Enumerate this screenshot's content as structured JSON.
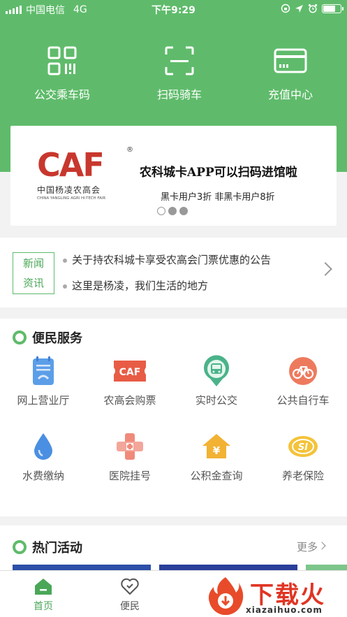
{
  "status_bar": {
    "carrier": "中国电信",
    "network": "4G",
    "time": "下午9:29"
  },
  "quick_actions": [
    {
      "label": "公交乘车码",
      "icon": "qr-code-icon"
    },
    {
      "label": "扫码骑车",
      "icon": "scan-icon"
    },
    {
      "label": "充值中心",
      "icon": "card-icon"
    }
  ],
  "banner": {
    "logo_text": "CAF",
    "logo_cn": "中国杨凌农高会",
    "logo_en": "CHINA YANGLING AGRI HI-TECH FAIR",
    "title": "农科城卡APP可以扫码进馆啦",
    "subtitle": "黑卡用户3折  非黑卡用户8折",
    "page_count": 3,
    "active_page": 1
  },
  "news": {
    "tag": "新闻资讯",
    "tag_line1": "新闻",
    "tag_line2": "资讯",
    "items": [
      "关于持农科城卡享受农高会门票优惠的公告",
      "这里是杨凌，我们生活的地方"
    ]
  },
  "services": {
    "title": "便民服务",
    "items": [
      {
        "label": "网上营业厅",
        "icon": "online-hall-icon"
      },
      {
        "label": "农高会购票",
        "icon": "caf-ticket-icon"
      },
      {
        "label": "实时公交",
        "icon": "bus-icon"
      },
      {
        "label": "公共自行车",
        "icon": "bicycle-icon"
      },
      {
        "label": "水费缴纳",
        "icon": "water-drop-icon"
      },
      {
        "label": "医院挂号",
        "icon": "hospital-icon"
      },
      {
        "label": "公积金查询",
        "icon": "housing-fund-icon"
      },
      {
        "label": "养老保险",
        "icon": "pension-insurance-icon"
      }
    ]
  },
  "activities": {
    "title": "热门活动",
    "more": "更多"
  },
  "tabbar": {
    "tabs": [
      {
        "label": "首页",
        "icon": "home-icon",
        "active": true
      },
      {
        "label": "便民",
        "icon": "heart-icon",
        "active": false
      }
    ]
  },
  "watermark": {
    "brand": "下载火",
    "url": "xiazaihuo.com"
  },
  "colors": {
    "primary_green": "#5fbb6b",
    "accent_red": "#c8372d"
  }
}
